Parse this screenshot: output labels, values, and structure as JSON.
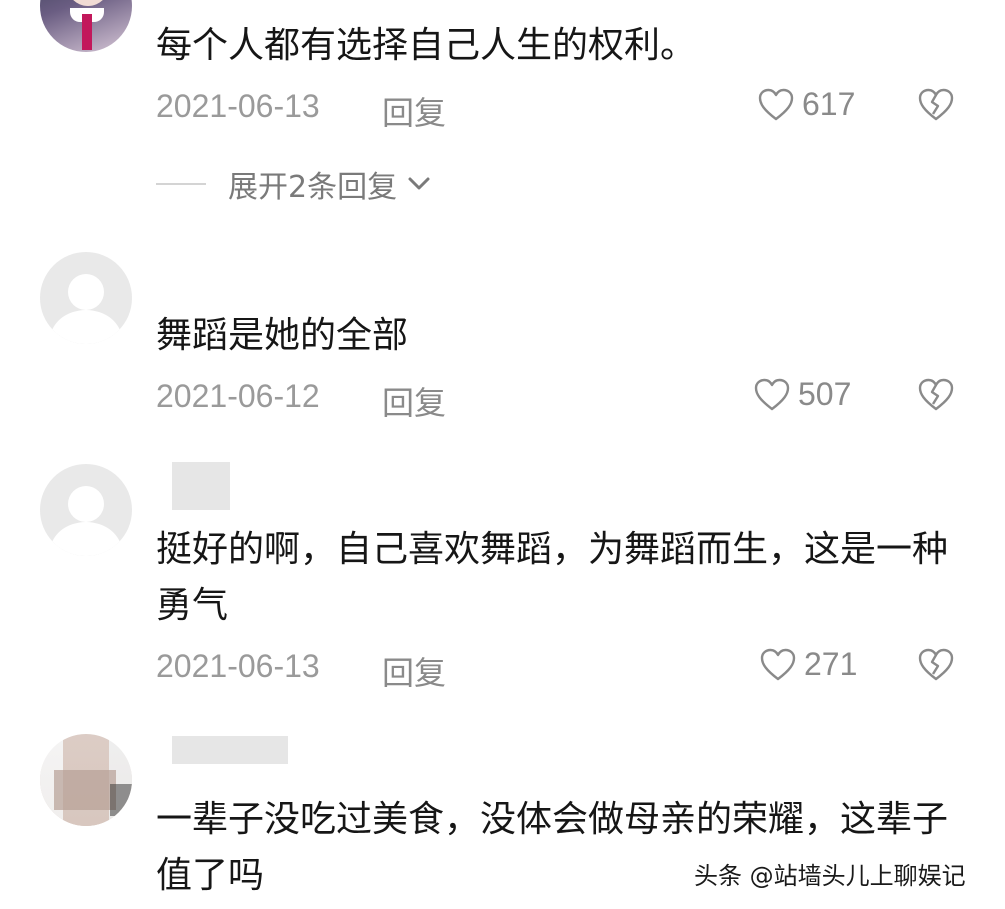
{
  "comments": [
    {
      "text": "每个人都有选择自己人生的权利。",
      "date": "2021-06-13",
      "reply_label": "回复",
      "likes": "617",
      "expand_label": "展开2条回复"
    },
    {
      "text": "舞蹈是她的全部",
      "date": "2021-06-12",
      "reply_label": "回复",
      "likes": "507"
    },
    {
      "text": "挺好的啊，自己喜欢舞蹈，为舞蹈而生，这是一种勇气",
      "date": "2021-06-13",
      "reply_label": "回复",
      "likes": "271"
    },
    {
      "text": "一辈子没吃过美食，没体会做母亲的荣耀，这辈子值了吗"
    }
  ],
  "watermark": "头条 @站墙头儿上聊娱记",
  "icons": {
    "like": "heart-outline-icon",
    "dislike": "broken-heart-icon",
    "expand": "chevron-down-icon"
  },
  "colors": {
    "text": "#161616",
    "meta": "#9a9a9a",
    "icon": "#8a8a8a"
  }
}
